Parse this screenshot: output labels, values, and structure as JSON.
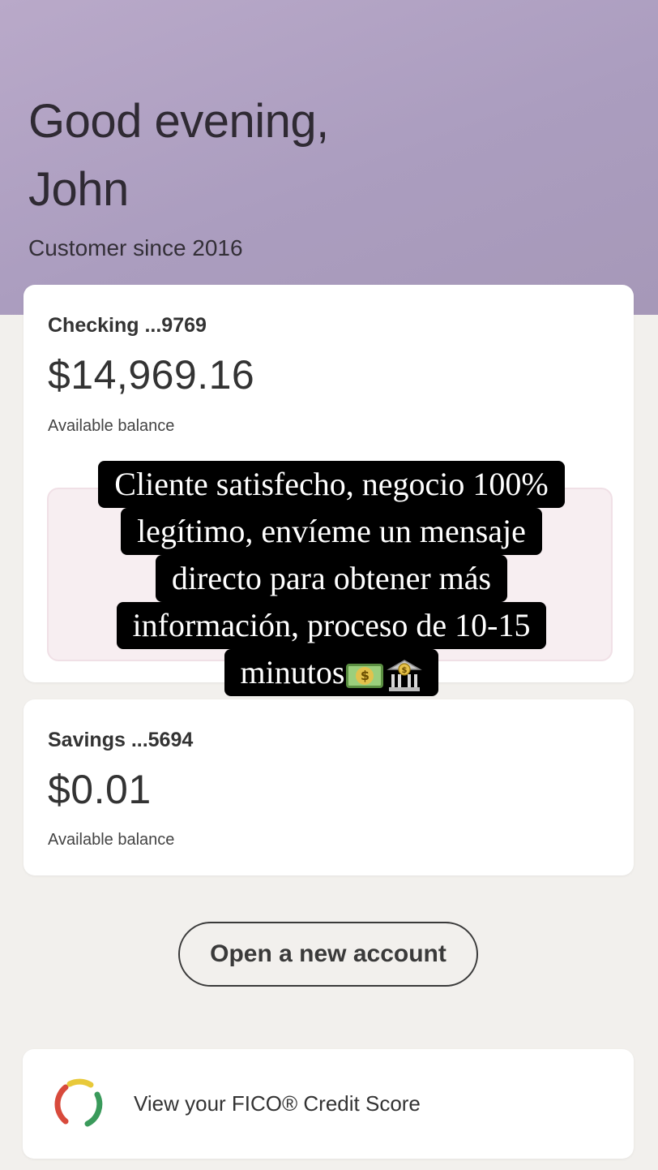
{
  "header": {
    "greeting_line1": "Good evening,",
    "greeting_line2": "John",
    "customer_since": "Customer since 2016"
  },
  "accounts": [
    {
      "name": "Checking ...9769",
      "balance": "$14,969.16",
      "balance_label": "Available balance"
    },
    {
      "name": "Savings ...5694",
      "balance": "$0.01",
      "balance_label": "Available balance"
    }
  ],
  "overlay": {
    "lines": [
      "Cliente satisfecho, negocio 100%",
      "legítimo, envíeme un mensaje",
      "directo para obtener más",
      "información, proceso de 10-15",
      "minutos"
    ],
    "emojis": [
      "money-with-wings-icon",
      "bank-icon"
    ]
  },
  "actions": {
    "open_account_label": "Open a new account"
  },
  "fico": {
    "label": "View your FICO® Credit Score",
    "icon": "credit-score-gauge-icon",
    "colors": [
      "#d84a3c",
      "#e8c93a",
      "#3a9a5b"
    ]
  },
  "colors": {
    "hero": "#b9a9c9",
    "background": "#f2f0ed",
    "card": "#ffffff",
    "overlay_bg": "#000000"
  }
}
